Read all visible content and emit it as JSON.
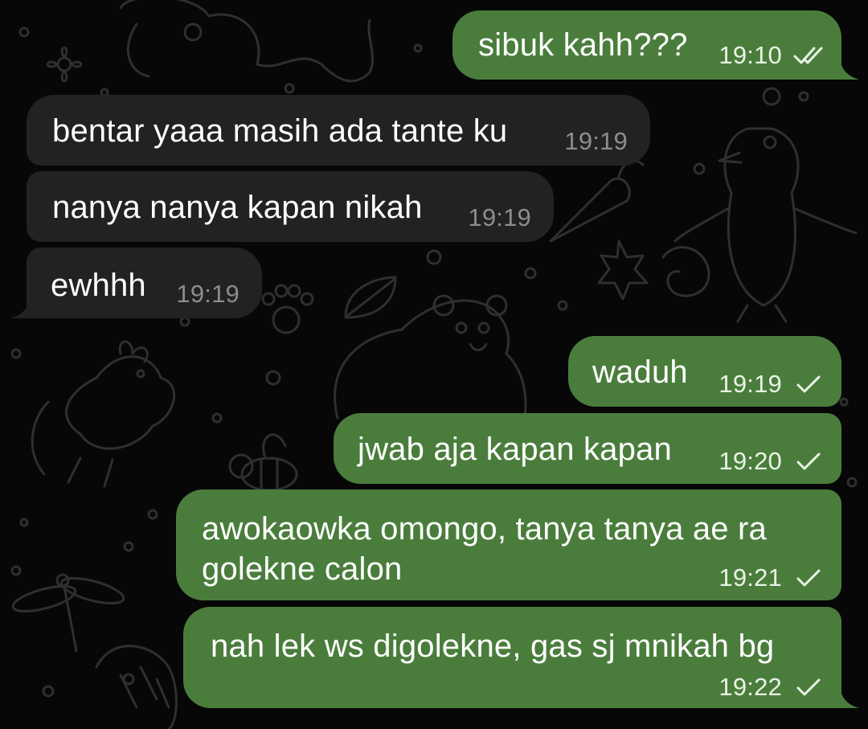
{
  "colors": {
    "background": "#070707",
    "doodle_stroke": "#2f2f2f",
    "incoming_bubble": "#222222",
    "outgoing_bubble": "#4a7d3c",
    "incoming_time": "#8d8d8d",
    "outgoing_time": "#e9f3e5"
  },
  "messages": [
    {
      "id": "m1",
      "direction": "outgoing",
      "text": "sibuk kahh???",
      "time": "19:10",
      "status": "read",
      "status_icon": "double-check-icon"
    },
    {
      "id": "m2",
      "direction": "incoming",
      "text": "bentar yaaa masih ada tante ku",
      "time": "19:19"
    },
    {
      "id": "m3",
      "direction": "incoming",
      "text": "nanya nanya kapan nikah",
      "time": "19:19"
    },
    {
      "id": "m4",
      "direction": "incoming",
      "text": "ewhhh",
      "time": "19:19"
    },
    {
      "id": "m5",
      "direction": "outgoing",
      "text": "waduh",
      "time": "19:19",
      "status": "sent",
      "status_icon": "single-check-icon"
    },
    {
      "id": "m6",
      "direction": "outgoing",
      "text": "jwab aja kapan kapan",
      "time": "19:20",
      "status": "sent",
      "status_icon": "single-check-icon"
    },
    {
      "id": "m7",
      "direction": "outgoing",
      "text": "awokaowka omongo, tanya tanya ae ra golekne calon",
      "time": "19:21",
      "status": "sent",
      "status_icon": "single-check-icon"
    },
    {
      "id": "m8",
      "direction": "outgoing",
      "text": "nah lek ws digolekne, gas sj mnikah bg",
      "time": "19:22",
      "status": "sent",
      "status_icon": "single-check-icon"
    }
  ]
}
